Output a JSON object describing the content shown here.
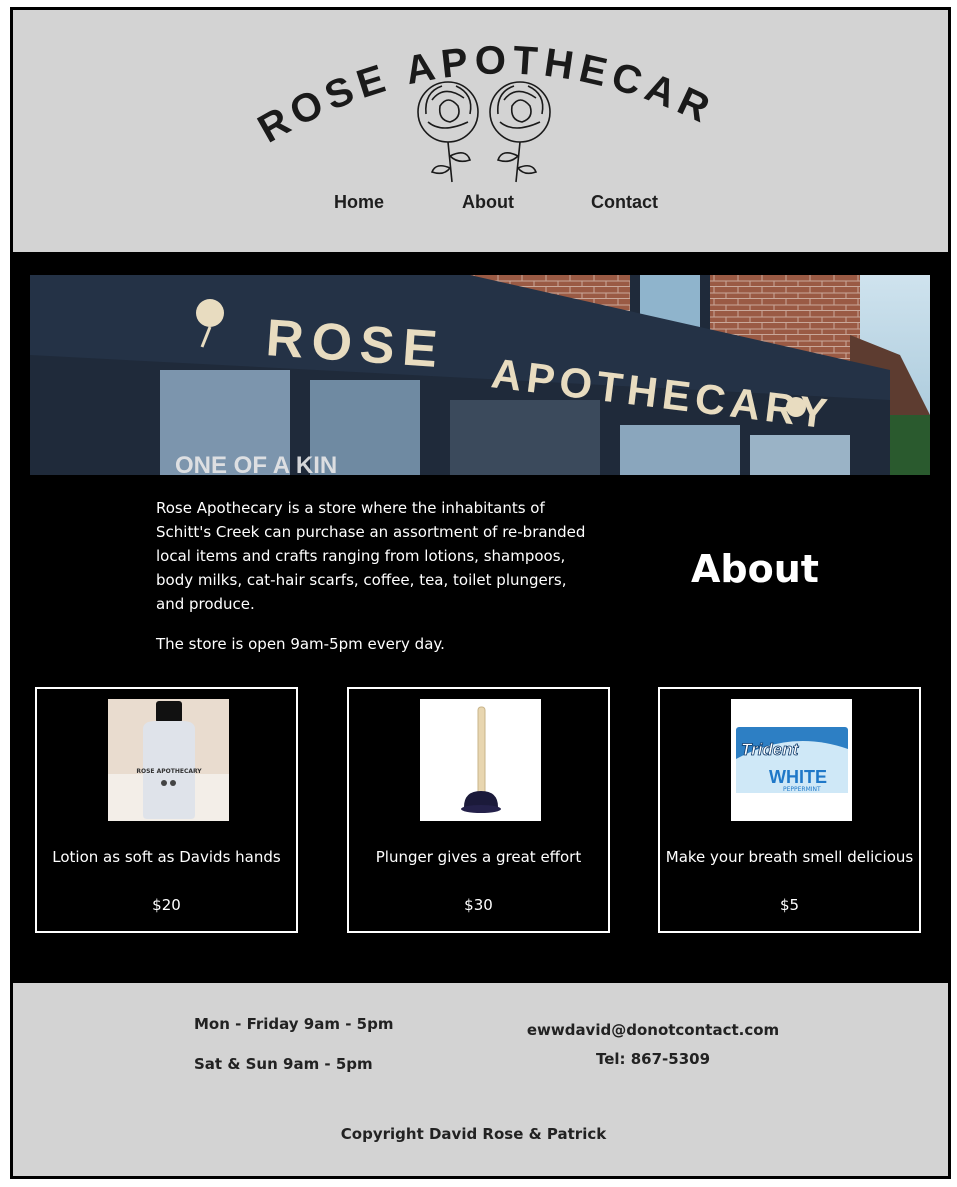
{
  "brand": {
    "name": "ROSE APOTHECARY"
  },
  "nav": {
    "items": [
      {
        "label": "Home"
      },
      {
        "label": "About"
      },
      {
        "label": "Contact"
      }
    ]
  },
  "hero": {
    "sign_text_1": "ROSE",
    "sign_text_2": "APOTHECARY",
    "window_text": "ONE OF A KIN"
  },
  "about": {
    "heading": "About",
    "paragraphs": [
      "Rose Apothecary is a store where the inhabitants of Schitt's Creek can purchase an assortment of re-branded local items and crafts ranging from lotions, shampoos, body milks, cat-hair scarfs, coffee, tea, toilet plungers, and produce.",
      "The store is open 9am-5pm every day."
    ]
  },
  "products": [
    {
      "description": "Lotion as soft as Davids hands",
      "price": "$20",
      "image_icon": "lotion-bottle-icon",
      "image_text": "ROSE APOTHECARY"
    },
    {
      "description": "Plunger gives a great effort",
      "price": "$30",
      "image_icon": "plunger-icon"
    },
    {
      "description": "Make your breath smell delicious",
      "price": "$5",
      "image_icon": "gum-pack-icon",
      "image_text_1": "Trident",
      "image_text_2": "WHITE",
      "image_text_3": "PEPPERMINT"
    }
  ],
  "footer": {
    "hours_weekday": "Mon - Friday 9am - 5pm",
    "hours_weekend": "Sat & Sun 9am - 5pm",
    "email": "ewwdavid@donotcontact.com",
    "phone": "Tel: 867-5309",
    "copyright": "Copyright David Rose & Patrick"
  },
  "colors": {
    "header_bg": "#d3d3d3",
    "body_bg": "#000000",
    "text_light": "#ffffff",
    "text_dark": "#1e1e1e",
    "storefront_navy": "#1f2a3a",
    "sign_letters": "#e8dcc0",
    "brick": "#9a5a44"
  }
}
